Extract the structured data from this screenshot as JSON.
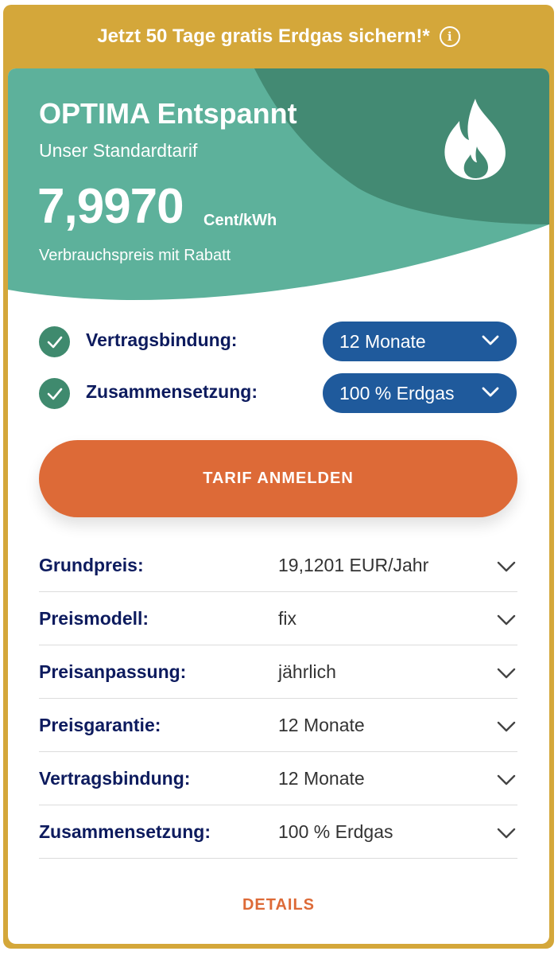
{
  "banner": {
    "text": "Jetzt 50 Tage gratis Erdgas sichern!*",
    "info_icon": "info-icon"
  },
  "tariff": {
    "name": "OPTIMA Entspannt",
    "subtitle": "Unser Standardtarif",
    "price": "7,9970",
    "unit": "Cent/kWh",
    "price_note": "Verbrauchspreis mit Rabatt",
    "icon": "flame-icon"
  },
  "options": [
    {
      "label": "Vertragsbindung:",
      "value": "12 Monate"
    },
    {
      "label": "Zusammensetzung:",
      "value": "100 % Erdgas"
    }
  ],
  "cta": {
    "label": "TARIF ANMELDEN"
  },
  "details": [
    {
      "label": "Grundpreis:",
      "value": "19,1201 EUR/Jahr"
    },
    {
      "label": "Preismodell:",
      "value": "fix"
    },
    {
      "label": "Preisanpassung:",
      "value": "jährlich"
    },
    {
      "label": "Preisgarantie:",
      "value": "12 Monate"
    },
    {
      "label": "Vertragsbindung:",
      "value": "12 Monate"
    },
    {
      "label": "Zusammensetzung:",
      "value": "100 % Erdgas"
    }
  ],
  "details_link": "DETAILS",
  "colors": {
    "banner": "#d4a73a",
    "hero_light": "#5bb09a",
    "hero_dark": "#438a73",
    "select_bg": "#1f5a9c",
    "cta": "#dd6a37",
    "label_text": "#0d1b5e"
  }
}
